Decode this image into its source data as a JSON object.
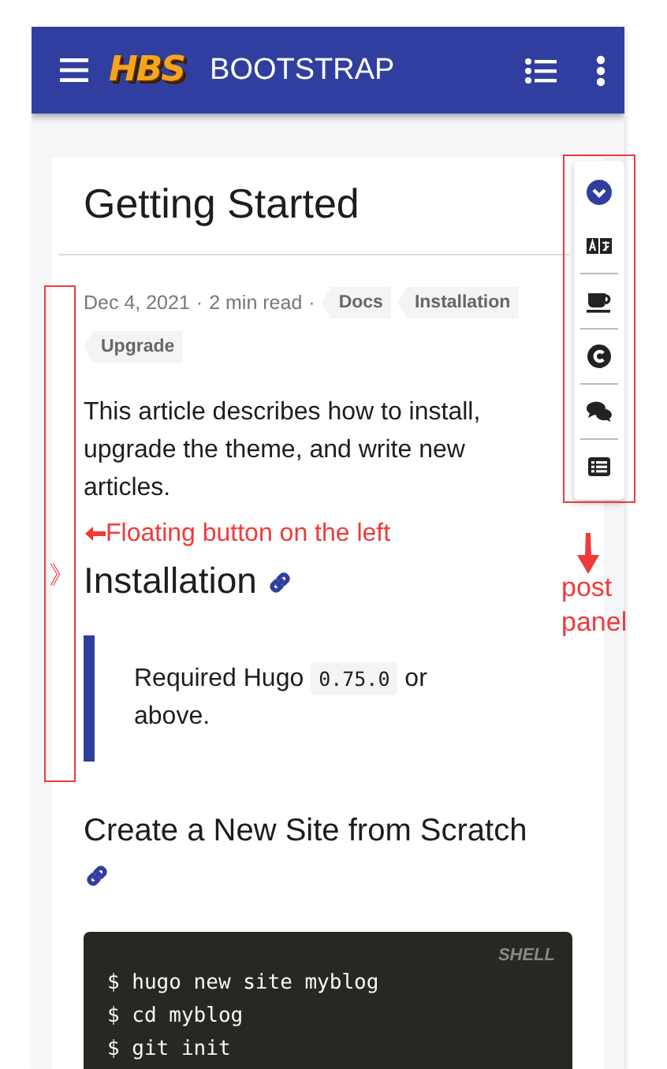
{
  "header": {
    "logo": "HBS",
    "title": "BOOTSTRAP"
  },
  "post": {
    "title": "Getting Started",
    "date": "Dec 4, 2021",
    "reading_time": "2 min read",
    "separator": "·",
    "tags": [
      "Docs",
      "Installation",
      "Upgrade"
    ],
    "blocks": [
      {
        "kind": "paragraph",
        "text": "This article describes how to install, upgrade the theme, and write new articles."
      },
      {
        "kind": "h2",
        "text": "Installation"
      },
      {
        "kind": "blockquote",
        "before": "Required Hugo ",
        "code": "0.75.0",
        "after": " or above."
      },
      {
        "kind": "h3",
        "text": "Create a New Site from Scratch"
      },
      {
        "kind": "code",
        "language": "SHELL",
        "lines": [
          "$ hugo new site myblog",
          "$ cd myblog",
          "$ git init"
        ]
      }
    ]
  },
  "post_panel": [
    {
      "kind": "chevron"
    },
    {
      "kind": "translate"
    },
    {
      "kind": "coffee"
    },
    {
      "kind": "copyright"
    },
    {
      "kind": "comments"
    },
    {
      "kind": "list"
    }
  ],
  "annotations": {
    "floating_button": "》",
    "note": "Floating button on the left",
    "panel_label": "post panel"
  }
}
